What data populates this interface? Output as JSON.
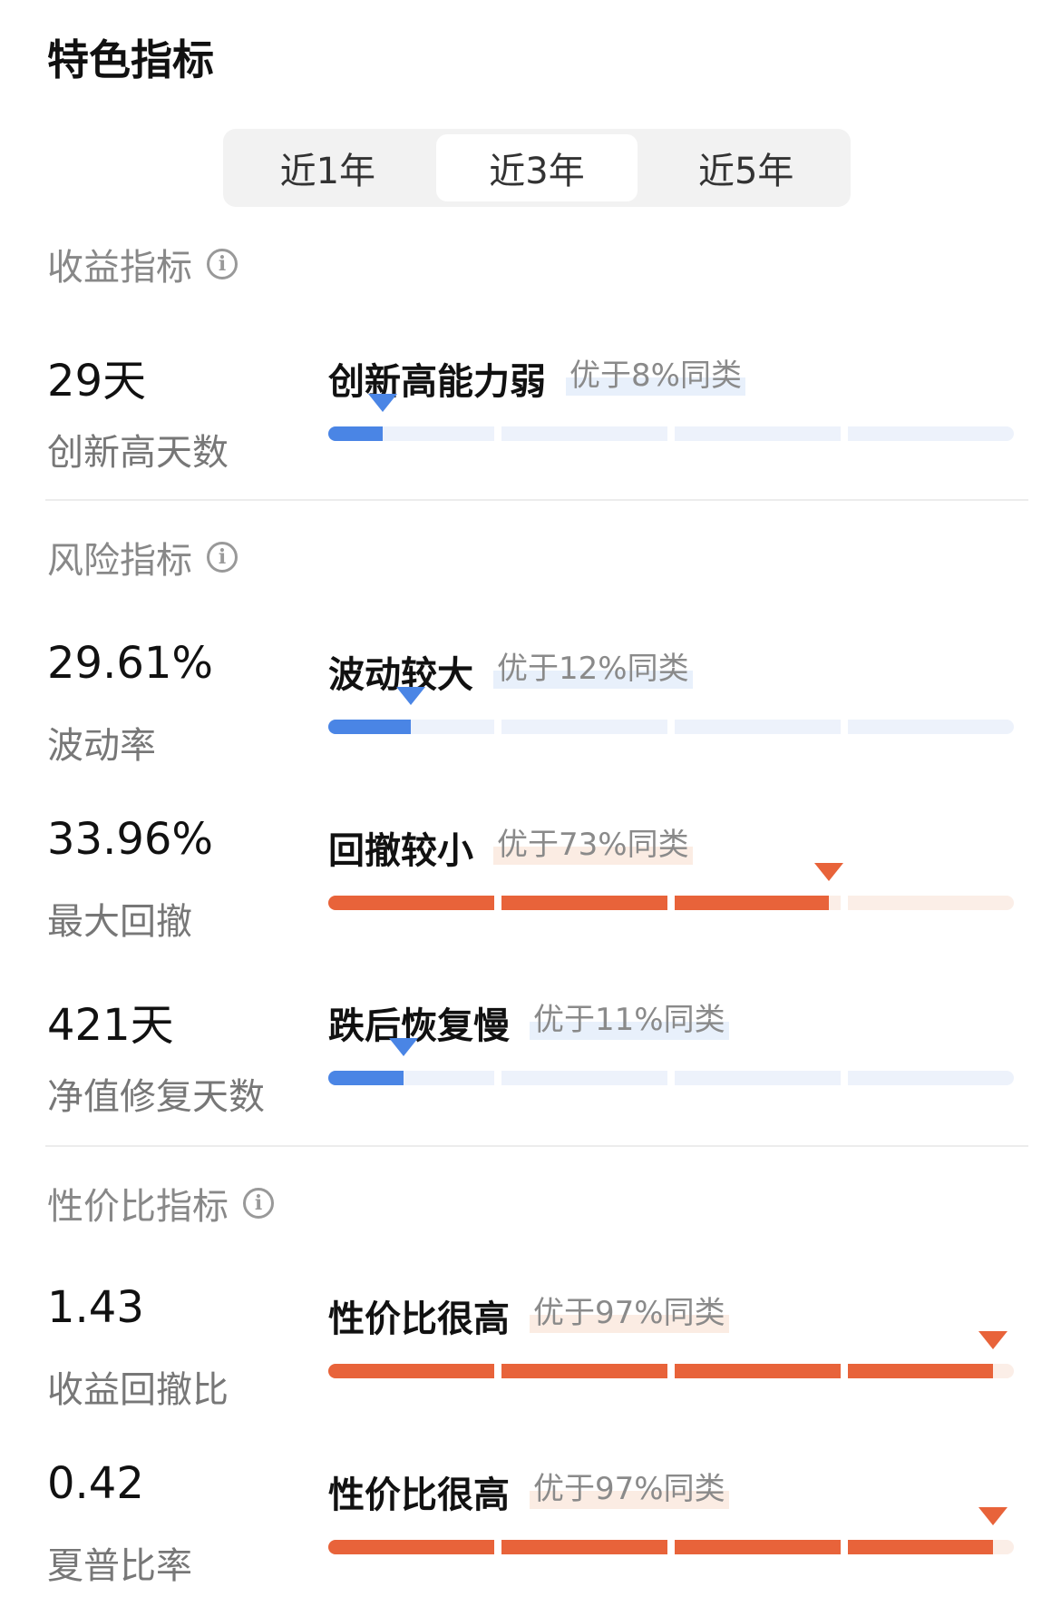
{
  "page_title": "特色指标",
  "tabs": [
    {
      "label": "近1年",
      "active": false
    },
    {
      "label": "近3年",
      "active": true
    },
    {
      "label": "近5年",
      "active": false
    }
  ],
  "info_icon": "info-icon",
  "colors": {
    "blue": "#4a85e5",
    "orange": "#e8633a"
  },
  "sections": {
    "return": {
      "title": "收益指标",
      "metrics": [
        {
          "value": "29天",
          "label": "创新高天数",
          "desc": "创新高能力弱",
          "badge": "优于8%同类",
          "percentile": 8,
          "color": "blue"
        }
      ]
    },
    "risk": {
      "title": "风险指标",
      "metrics": [
        {
          "value": "29.61%",
          "label": "波动率",
          "desc": "波动较大",
          "badge": "优于12%同类",
          "percentile": 12,
          "color": "blue"
        },
        {
          "value": "33.96%",
          "label": "最大回撤",
          "desc": "回撤较小",
          "badge": "优于73%同类",
          "percentile": 73,
          "color": "orange"
        },
        {
          "value": "421天",
          "label": "净值修复天数",
          "desc": "跌后恢复慢",
          "badge": "优于11%同类",
          "percentile": 11,
          "color": "blue"
        }
      ]
    },
    "value": {
      "title": "性价比指标",
      "metrics": [
        {
          "value": "1.43",
          "label": "收益回撤比",
          "desc": "性价比很高",
          "badge": "优于97%同类",
          "percentile": 97,
          "color": "orange"
        },
        {
          "value": "0.42",
          "label": "夏普比率",
          "desc": "性价比很高",
          "badge": "优于97%同类",
          "percentile": 97,
          "color": "orange"
        }
      ]
    }
  }
}
